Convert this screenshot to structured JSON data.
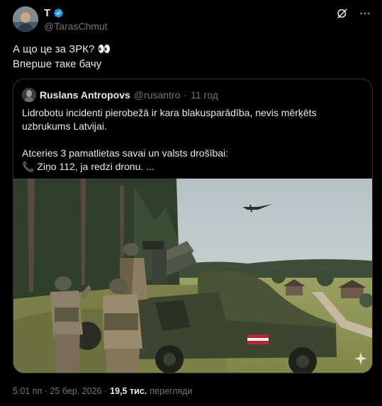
{
  "author": {
    "display_name": "T",
    "handle": "@TarasChmut"
  },
  "icons": [
    "verified-badge-icon",
    "grok-icon",
    "more-icon"
  ],
  "tweet": {
    "lines": [
      "А що це за ЗРК? 👀",
      "Вперше таке бачу"
    ]
  },
  "quote": {
    "display_name": "Ruslans Antropovs",
    "handle": "@rusantro",
    "separator": "·",
    "time": "11 год",
    "lines": [
      "Lidrobotu incidenti pierobežā ir kara blakusparādība, nevis mērķēts",
      "uzbrukums Latvijai.",
      "Atceries 3 pamatlietas savai un valsts drošībai:",
      "📞 Ziņo 112, ja redzi dronu. ..."
    ]
  },
  "footer": {
    "timestamp": "5:01 пп · 25 бер. 2026 ·",
    "views_count": "19,5 тис.",
    "views_label": "перегляди"
  },
  "colors": {
    "background": "#000000",
    "text": "#e7e9ea",
    "muted": "#71767b",
    "border": "#2f3336",
    "verified": "#1d9bf0"
  }
}
